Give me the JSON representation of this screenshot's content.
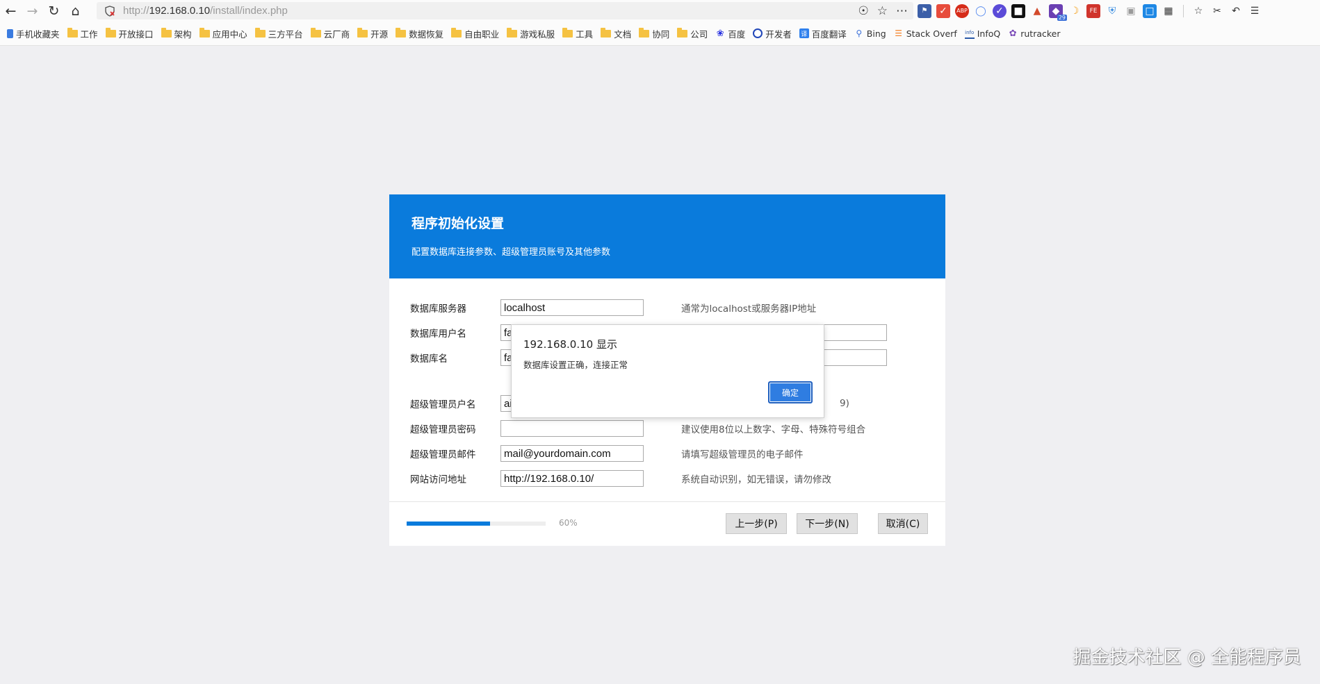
{
  "browser": {
    "url_prefix": "http://",
    "url_host": "192.168.0.10",
    "url_path": "/install/index.php",
    "bookmarks": [
      {
        "label": "手机收藏夹",
        "icon": "phone-icon"
      },
      {
        "label": "工作",
        "icon": "folder-icon"
      },
      {
        "label": "开放接口",
        "icon": "folder-icon"
      },
      {
        "label": "架构",
        "icon": "folder-icon"
      },
      {
        "label": "应用中心",
        "icon": "folder-icon"
      },
      {
        "label": "三方平台",
        "icon": "folder-icon"
      },
      {
        "label": "云厂商",
        "icon": "folder-icon"
      },
      {
        "label": "开源",
        "icon": "folder-icon"
      },
      {
        "label": "数据恢复",
        "icon": "folder-icon"
      },
      {
        "label": "自由职业",
        "icon": "folder-icon"
      },
      {
        "label": "游戏私服",
        "icon": "folder-icon"
      },
      {
        "label": "工具",
        "icon": "folder-icon"
      },
      {
        "label": "文档",
        "icon": "folder-icon"
      },
      {
        "label": "协同",
        "icon": "folder-icon"
      },
      {
        "label": "公司",
        "icon": "folder-icon"
      },
      {
        "label": "百度",
        "icon": "baidu-icon"
      },
      {
        "label": "开发者",
        "icon": "developer-icon"
      },
      {
        "label": "百度翻译",
        "icon": "translate-icon"
      },
      {
        "label": "Bing",
        "icon": "bing-icon"
      },
      {
        "label": "Stack Overf",
        "icon": "stackoverflow-icon"
      },
      {
        "label": "InfoQ",
        "icon": "infoq-icon"
      },
      {
        "label": "rutracker",
        "icon": "rutracker-icon"
      }
    ],
    "extension_badge": "29"
  },
  "installer": {
    "title": "程序初始化设置",
    "subtitle": "配置数据库连接参数、超级管理员账号及其他参数",
    "fields": [
      {
        "label": "数据库服务器",
        "value": "localhost",
        "hint": "通常为localhost或服务器IP地址"
      },
      {
        "label": "数据库用户名",
        "value": "fa",
        "hint": ""
      },
      {
        "label": "数据库名",
        "value": "fa",
        "hint": ""
      },
      {
        "label": "超级管理员户名",
        "value": "ai",
        "hint": "9)"
      },
      {
        "label": "超级管理员密码",
        "value": "",
        "hint": "建议使用8位以上数字、字母、特殊符号组合"
      },
      {
        "label": "超级管理员邮件",
        "value": "mail@yourdomain.com",
        "hint": "请填写超级管理员的电子邮件"
      },
      {
        "label": "网站访问地址",
        "value": "http://192.168.0.10/",
        "hint": "系统自动识别，如无错误，请勿修改"
      }
    ],
    "progress": {
      "percent": 60,
      "label": "60%"
    },
    "buttons": {
      "prev": "上一步(P)",
      "next": "下一步(N)",
      "cancel": "取消(C)"
    }
  },
  "alert": {
    "title": "192.168.0.10 显示",
    "message": "数据库设置正确，连接正常",
    "ok": "确定"
  },
  "watermark": "掘金技术社区 @ 全能程序员"
}
